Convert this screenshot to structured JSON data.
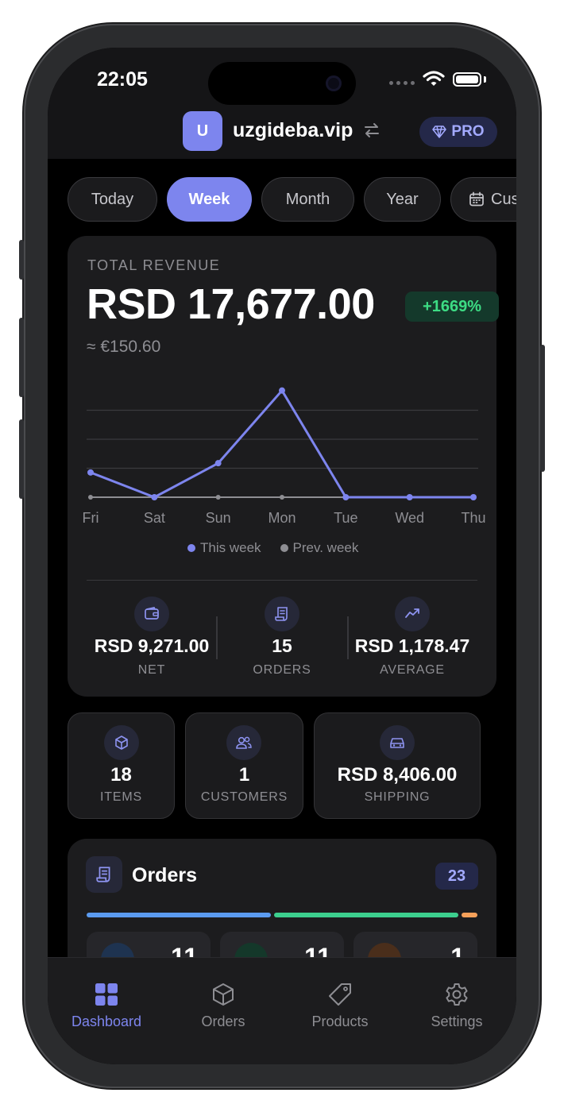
{
  "status_bar": {
    "time": "22:05"
  },
  "header": {
    "avatar_letter": "U",
    "store_name": "uzgideba.vip",
    "pro_label": "PRO"
  },
  "filters": [
    {
      "label": "Today",
      "active": false
    },
    {
      "label": "Week",
      "active": true
    },
    {
      "label": "Month",
      "active": false
    },
    {
      "label": "Year",
      "active": false
    },
    {
      "label": "Custom",
      "active": false
    }
  ],
  "revenue": {
    "label": "TOTAL REVENUE",
    "value": "RSD 17,677.00",
    "change": "+1669%",
    "approx_eur": "≈ €150.60"
  },
  "chart_data": {
    "type": "line",
    "categories": [
      "Fri",
      "Sat",
      "Sun",
      "Mon",
      "Tue",
      "Wed",
      "Thu"
    ],
    "series": [
      {
        "name": "This week",
        "values": [
          3200,
          0,
          4400,
          13800,
          0,
          0,
          0
        ],
        "color": "#7d85ee"
      },
      {
        "name": "Prev. week",
        "values": [
          0,
          0,
          0,
          0,
          0,
          0,
          0
        ],
        "color": "#8e8e93"
      }
    ],
    "ylim": [
      0,
      15000
    ],
    "grid": true,
    "legend": "bottom"
  },
  "stats": [
    {
      "value": "RSD 9,271.00",
      "label": "NET",
      "icon": "wallet-icon"
    },
    {
      "value": "15",
      "label": "ORDERS",
      "icon": "receipt-icon"
    },
    {
      "value": "RSD 1,178.47",
      "label": "AVERAGE",
      "icon": "trend-icon"
    }
  ],
  "mini_stats": [
    {
      "value": "18",
      "label": "ITEMS",
      "icon": "box-icon"
    },
    {
      "value": "1",
      "label": "CUSTOMERS",
      "icon": "users-icon"
    },
    {
      "value": "RSD 8,406.00",
      "label": "SHIPPING",
      "icon": "car-icon"
    }
  ],
  "orders": {
    "title": "Orders",
    "count": "23",
    "status_counts": [
      "11",
      "11",
      "1"
    ],
    "status_colors": [
      "#5b9bf0",
      "#3ccf8e",
      "#f5a05a"
    ]
  },
  "tabs": [
    {
      "label": "Dashboard",
      "icon": "grid-icon",
      "active": true
    },
    {
      "label": "Orders",
      "icon": "cube-icon",
      "active": false
    },
    {
      "label": "Products",
      "icon": "tag-icon",
      "active": false
    },
    {
      "label": "Settings",
      "icon": "gear-icon",
      "active": false
    }
  ],
  "colors": {
    "accent": "#7d85ee",
    "positive": "#3ddc84",
    "card": "#1c1c1e",
    "background": "#000000"
  }
}
